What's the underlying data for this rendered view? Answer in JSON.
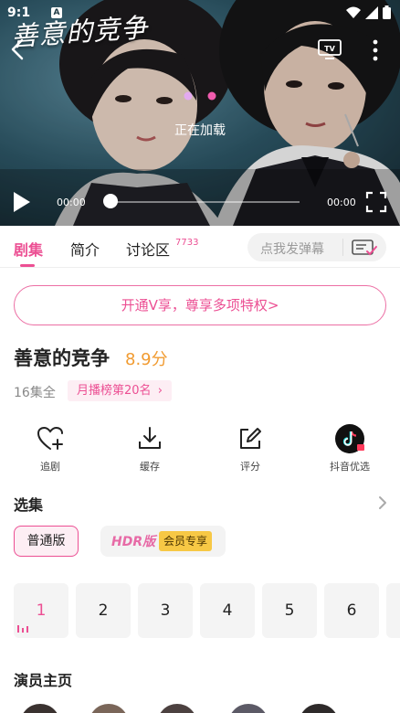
{
  "status_bar": {
    "time": "9:1",
    "notification_glyph": "A"
  },
  "player": {
    "title": "善意的竞争",
    "loading_text": "正在加载",
    "current_time": "00:00",
    "total_time": "00:00",
    "progress": 0.0,
    "icons": [
      "back-icon",
      "tv-cast-icon",
      "more-icon",
      "play-icon",
      "fullscreen-icon"
    ]
  },
  "tabs": {
    "items": [
      {
        "label": "剧集",
        "active": true
      },
      {
        "label": "简介",
        "active": false
      },
      {
        "label": "讨论区",
        "active": false
      }
    ],
    "discussion_count": "7733",
    "danmaku_placeholder": "点我发弹幕"
  },
  "vip_banner": "开通V享，尊享多项特权>",
  "show": {
    "title": "善意的竞争",
    "score": "8.9分",
    "episode_count": "16集全",
    "rank": "月播榜第20名"
  },
  "actions": [
    {
      "label": "追剧",
      "icon": "heart-plus-icon"
    },
    {
      "label": "缓存",
      "icon": "download-icon"
    },
    {
      "label": "评分",
      "icon": "edit-icon"
    },
    {
      "label": "抖音优选",
      "icon": "douyin-icon"
    }
  ],
  "episodes_section": {
    "title": "选集",
    "versions": {
      "standard": "普通版",
      "hdr": "HDR版",
      "hdr_badge": "会员专享"
    },
    "episodes": [
      "1",
      "2",
      "3",
      "4",
      "5",
      "6"
    ],
    "current": "1"
  },
  "cast_section": {
    "title": "演员主页"
  },
  "colors": {
    "accent": "#ec4f93",
    "score": "#f19b31",
    "gold_badge": "#f7c845"
  }
}
